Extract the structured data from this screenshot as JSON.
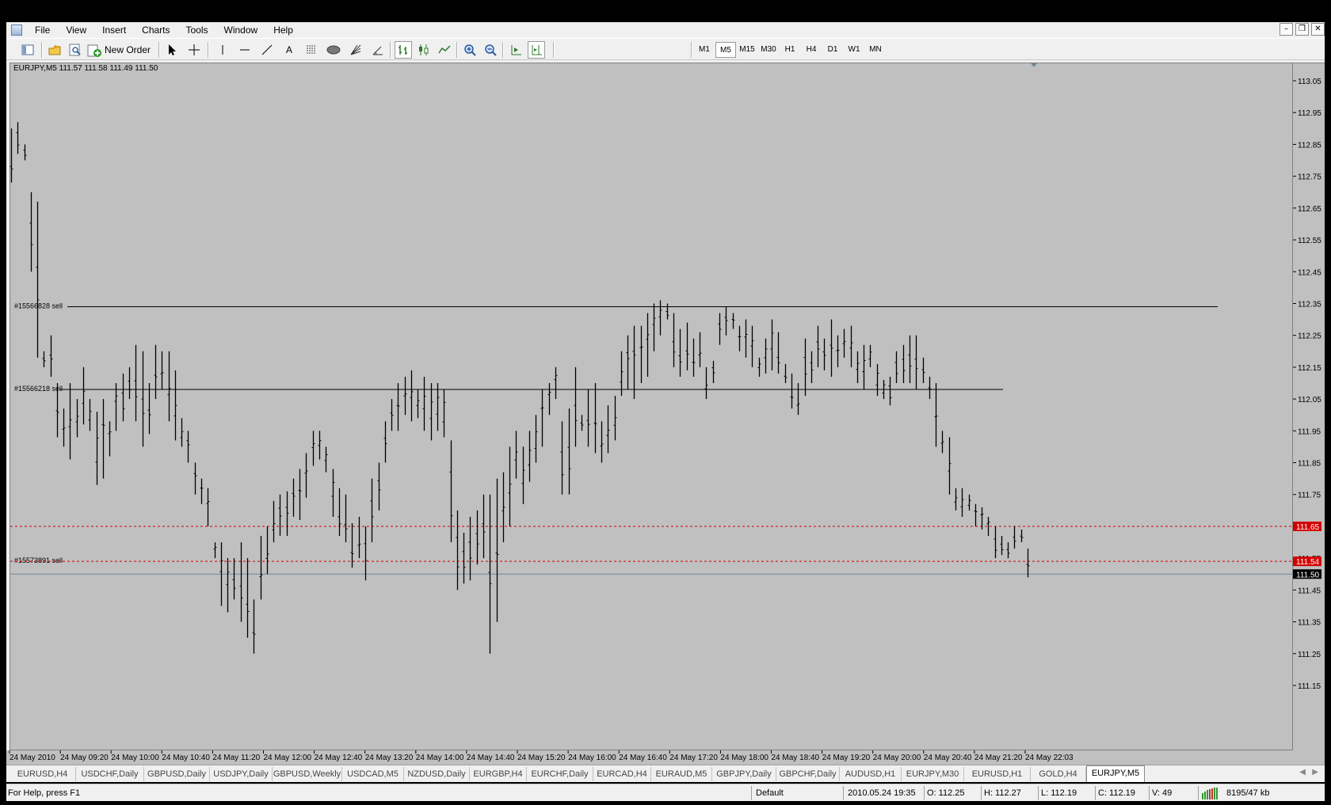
{
  "menu": {
    "items": [
      "File",
      "View",
      "Insert",
      "Charts",
      "Tools",
      "Window",
      "Help"
    ]
  },
  "window_controls": {
    "minimize": "–",
    "restore": "❐",
    "close": "✕"
  },
  "toolbar": {
    "new_order_label": "New Order",
    "timeframes": [
      "M1",
      "M5",
      "M15",
      "M30",
      "H1",
      "H4",
      "D1",
      "W1",
      "MN"
    ],
    "active_timeframe": "M5"
  },
  "chart": {
    "header": "EURJPY,M5  111.57 111.58 111.49 111.50",
    "order_labels": [
      "#15566828 sell",
      "#15566218 sell",
      "#15573891 sell"
    ]
  },
  "chart_data": {
    "type": "ohlc",
    "symbol": "EURJPY",
    "timeframe": "M5",
    "last_ohlc": {
      "open": 111.57,
      "high": 111.58,
      "low": 111.49,
      "close": 111.5
    },
    "y_ticks": [
      "113.05",
      "112.95",
      "112.85",
      "112.75",
      "112.65",
      "112.55",
      "112.45",
      "112.35",
      "112.25",
      "112.15",
      "112.05",
      "111.95",
      "111.85",
      "111.75",
      "111.65",
      "111.55",
      "111.45",
      "111.35",
      "111.25",
      "111.15"
    ],
    "ylim": [
      111.1,
      113.1
    ],
    "x_ticks": [
      "24 May 2010",
      "24 May 09:20",
      "24 May 10:00",
      "24 May 10:40",
      "24 May 11:20",
      "24 May 12:00",
      "24 May 12:40",
      "24 May 13:20",
      "24 May 14:00",
      "24 May 14:40",
      "24 May 15:20",
      "24 May 16:00",
      "24 May 16:40",
      "24 May 17:20",
      "24 May 18:00",
      "24 May 18:40",
      "24 May 19:20",
      "24 May 20:00",
      "24 May 20:40",
      "24 May 21:20",
      "24 May 22:03"
    ],
    "order_lines": [
      {
        "label": "#15566828 sell",
        "price": 112.34
      },
      {
        "label": "#15566218 sell",
        "price": 112.08
      },
      {
        "label": "#15573891 sell",
        "price": 111.54
      }
    ],
    "level_lines": [
      {
        "price": 111.65,
        "label": "111.65",
        "style": "dashed",
        "color": "#d40000"
      },
      {
        "price": 111.54,
        "label": "111.54",
        "style": "dashed",
        "color": "#d40000"
      }
    ],
    "current_price": {
      "price": 111.5,
      "label": "111.50"
    },
    "bars": [
      [
        112.73,
        112.9
      ],
      [
        112.82,
        112.92
      ],
      [
        112.8,
        112.85
      ],
      [
        112.45,
        112.7
      ],
      [
        112.18,
        112.67
      ],
      [
        112.15,
        112.2
      ],
      [
        112.12,
        112.25
      ],
      [
        111.93,
        112.1
      ],
      [
        111.9,
        112.02
      ],
      [
        111.86,
        112.1
      ],
      [
        111.93,
        112.05
      ],
      [
        111.97,
        112.15
      ],
      [
        111.95,
        112.05
      ],
      [
        111.78,
        112.01
      ],
      [
        111.8,
        112.05
      ],
      [
        111.87,
        111.98
      ],
      [
        111.95,
        112.1
      ],
      [
        111.98,
        112.13
      ],
      [
        112.05,
        112.15
      ],
      [
        111.98,
        112.22
      ],
      [
        111.9,
        112.2
      ],
      [
        111.94,
        112.1
      ],
      [
        112.05,
        112.22
      ],
      [
        112.08,
        112.2
      ],
      [
        111.98,
        112.2
      ],
      [
        111.92,
        112.14
      ],
      [
        111.9,
        111.99
      ],
      [
        111.85,
        111.95
      ],
      [
        111.75,
        111.85
      ],
      [
        111.72,
        111.8
      ],
      [
        111.65,
        111.77
      ],
      [
        111.55,
        111.6
      ],
      [
        111.4,
        111.6
      ],
      [
        111.38,
        111.55
      ],
      [
        111.42,
        111.55
      ],
      [
        111.35,
        111.6
      ],
      [
        111.3,
        111.55
      ],
      [
        111.25,
        111.42
      ],
      [
        111.42,
        111.62
      ],
      [
        111.5,
        111.65
      ],
      [
        111.6,
        111.73
      ],
      [
        111.62,
        111.75
      ],
      [
        111.62,
        111.76
      ],
      [
        111.68,
        111.8
      ],
      [
        111.67,
        111.83
      ],
      [
        111.74,
        111.88
      ],
      [
        111.84,
        111.95
      ],
      [
        111.86,
        111.95
      ],
      [
        111.82,
        111.9
      ],
      [
        111.68,
        111.83
      ],
      [
        111.62,
        111.77
      ],
      [
        111.6,
        111.75
      ],
      [
        111.52,
        111.66
      ],
      [
        111.55,
        111.68
      ],
      [
        111.48,
        111.65
      ],
      [
        111.6,
        111.8
      ],
      [
        111.7,
        111.85
      ],
      [
        111.85,
        111.98
      ],
      [
        111.95,
        112.05
      ],
      [
        111.95,
        112.1
      ],
      [
        112.0,
        112.12
      ],
      [
        111.98,
        112.14
      ],
      [
        111.99,
        112.08
      ],
      [
        111.95,
        112.12
      ],
      [
        111.92,
        112.1
      ],
      [
        111.95,
        112.1
      ],
      [
        111.93,
        112.08
      ],
      [
        111.6,
        111.92
      ],
      [
        111.45,
        111.7
      ],
      [
        111.47,
        111.63
      ],
      [
        111.48,
        111.68
      ],
      [
        111.53,
        111.7
      ],
      [
        111.55,
        111.75
      ],
      [
        111.25,
        111.75
      ],
      [
        111.35,
        111.8
      ],
      [
        111.6,
        111.82
      ],
      [
        111.65,
        111.9
      ],
      [
        111.8,
        111.95
      ],
      [
        111.72,
        111.9
      ],
      [
        111.79,
        111.95
      ],
      [
        111.85,
        112.0
      ],
      [
        111.9,
        112.08
      ],
      [
        112.0,
        112.1
      ],
      [
        112.05,
        112.15
      ],
      [
        111.75,
        111.98
      ],
      [
        111.75,
        112.02
      ],
      [
        111.9,
        112.15
      ],
      [
        111.95,
        112.0
      ],
      [
        111.9,
        112.08
      ],
      [
        111.88,
        112.1
      ],
      [
        111.85,
        111.98
      ],
      [
        111.88,
        112.03
      ],
      [
        111.92,
        112.06
      ],
      [
        112.06,
        112.2
      ],
      [
        112.08,
        112.25
      ],
      [
        112.05,
        112.28
      ],
      [
        112.1,
        112.28
      ],
      [
        112.12,
        112.32
      ],
      [
        112.2,
        112.35
      ],
      [
        112.25,
        112.36
      ],
      [
        112.3,
        112.35
      ],
      [
        112.15,
        112.32
      ],
      [
        112.12,
        112.27
      ],
      [
        112.14,
        112.29
      ],
      [
        112.12,
        112.24
      ],
      [
        112.15,
        112.26
      ],
      [
        112.05,
        112.15
      ],
      [
        112.1,
        112.17
      ],
      [
        112.22,
        112.32
      ],
      [
        112.25,
        112.34
      ],
      [
        112.27,
        112.32
      ],
      [
        112.2,
        112.28
      ],
      [
        112.18,
        112.3
      ],
      [
        112.15,
        112.28
      ],
      [
        112.12,
        112.18
      ],
      [
        112.13,
        112.24
      ],
      [
        112.14,
        112.3
      ],
      [
        112.13,
        112.26
      ],
      [
        112.1,
        112.16
      ],
      [
        112.02,
        112.13
      ],
      [
        112.0,
        112.1
      ],
      [
        112.06,
        112.24
      ],
      [
        112.1,
        112.2
      ],
      [
        112.15,
        112.28
      ],
      [
        112.14,
        112.24
      ],
      [
        112.12,
        112.3
      ],
      [
        112.15,
        112.25
      ],
      [
        112.18,
        112.27
      ],
      [
        112.15,
        112.28
      ],
      [
        112.1,
        112.2
      ],
      [
        112.08,
        112.22
      ],
      [
        112.15,
        112.22
      ],
      [
        112.06,
        112.16
      ],
      [
        112.05,
        112.11
      ],
      [
        112.03,
        112.12
      ],
      [
        112.1,
        112.2
      ],
      [
        112.1,
        112.22
      ],
      [
        112.1,
        112.25
      ],
      [
        112.08,
        112.25
      ],
      [
        112.1,
        112.18
      ],
      [
        112.05,
        112.12
      ],
      [
        111.9,
        112.1
      ],
      [
        111.88,
        111.95
      ],
      [
        111.75,
        111.93
      ],
      [
        111.7,
        111.77
      ],
      [
        111.68,
        111.77
      ],
      [
        111.7,
        111.75
      ],
      [
        111.65,
        111.72
      ],
      [
        111.64,
        111.71
      ],
      [
        111.62,
        111.68
      ],
      [
        111.55,
        111.65
      ],
      [
        111.56,
        111.62
      ],
      [
        111.55,
        111.6
      ],
      [
        111.58,
        111.65
      ],
      [
        111.6,
        111.64
      ],
      [
        111.49,
        111.58
      ]
    ]
  },
  "symbol_tabs": [
    "EURUSD,H4",
    "USDCHF,Daily",
    "GBPUSD,Daily",
    "USDJPY,Daily",
    "GBPUSD,Weekly",
    "USDCAD,M5",
    "NZDUSD,Daily",
    "EURGBP,H4",
    "EURCHF,Daily",
    "EURCAD,H4",
    "EURAUD,M5",
    "GBPJPY,Daily",
    "GBPCHF,Daily",
    "AUDUSD,H1",
    "EURJPY,M30",
    "EURUSD,H1",
    "GOLD,H4",
    "EURJPY,M5"
  ],
  "active_tab": "EURJPY,M5",
  "status": {
    "help": "For Help, press F1",
    "profile": "Default",
    "datetime": "2010.05.24 19:35",
    "open": "O: 112.25",
    "high": "H: 112.27",
    "low": "L: 112.19",
    "close": "C: 112.19",
    "volume": "V: 49",
    "traffic": "8195/47 kb"
  }
}
